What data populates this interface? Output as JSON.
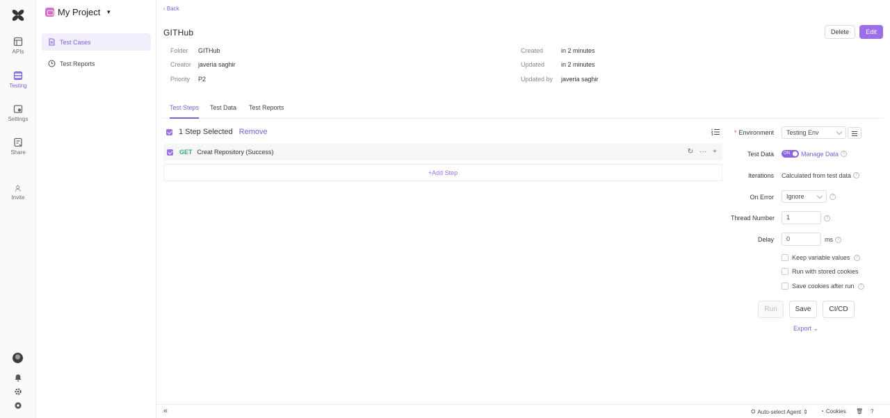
{
  "rail": {
    "items": [
      {
        "label": "APIs"
      },
      {
        "label": "Testing"
      },
      {
        "label": "Settings"
      },
      {
        "label": "Share"
      },
      {
        "label": "Invite"
      }
    ]
  },
  "sidebar": {
    "project_name": "My Project",
    "items": [
      {
        "label": "Test Cases"
      },
      {
        "label": "Test Reports"
      }
    ]
  },
  "main": {
    "back_label": "Back",
    "title": "GITHub",
    "meta_left": [
      {
        "key": "Folder",
        "value": "GITHub"
      },
      {
        "key": "Creator",
        "value": "javeria saghir"
      },
      {
        "key": "Priority",
        "value": "P2"
      }
    ],
    "meta_right": [
      {
        "key": "Created",
        "value": "in 2 minutes"
      },
      {
        "key": "Updated",
        "value": "in 2 minutes"
      },
      {
        "key": "Updated by",
        "value": "javeria saghir"
      }
    ],
    "delete_label": "Delete",
    "edit_label": "Edit",
    "tabs": [
      {
        "label": "Test Steps"
      },
      {
        "label": "Test Data"
      },
      {
        "label": "Test Reports"
      }
    ],
    "selection_text": "1 Step Selected",
    "remove_label": "Remove",
    "step": {
      "method": "GET",
      "name": "Creat Repository (Success)"
    },
    "add_step_label": "Add Step"
  },
  "runner": {
    "environment_label": "Environment",
    "environment_value": "Testing Env",
    "test_data_label": "Test Data",
    "toggle_label": "ON",
    "manage_data_label": "Manage Data",
    "iterations_label": "Iterations",
    "iterations_value": "Calculated from test data",
    "on_error_label": "On Error",
    "on_error_value": "Ignore",
    "thread_label": "Thread Number",
    "thread_value": "1",
    "delay_label": "Delay",
    "delay_value": "0",
    "delay_unit": "ms",
    "checkboxes": [
      {
        "label": "Keep variable values"
      },
      {
        "label": "Run with stored cookies"
      },
      {
        "label": "Save cookies after run"
      }
    ],
    "run_label": "Run",
    "save_label": "Save",
    "cicd_label": "CI/CD",
    "export_label": "Export"
  },
  "footer": {
    "agent_label": "Auto-select Agent",
    "cookies_label": "Cookies"
  },
  "colors": {
    "accent": "#9b6fe6",
    "get_method": "#3aa777"
  }
}
